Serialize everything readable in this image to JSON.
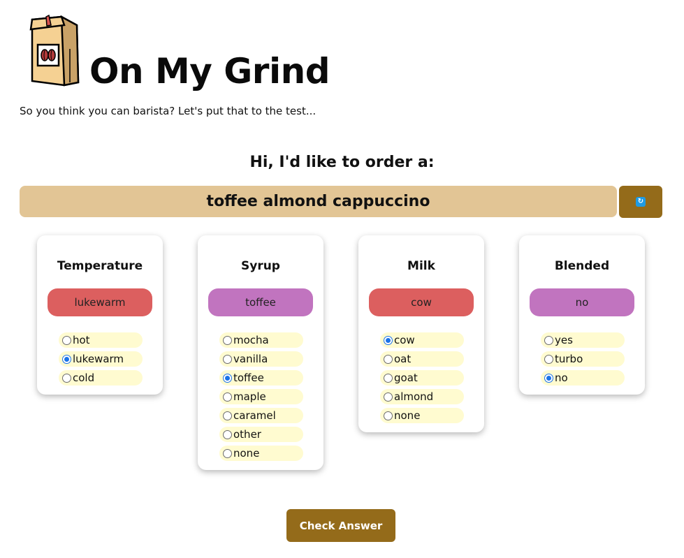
{
  "header": {
    "logo_icon": "coffee-bag-icon",
    "title": "On My Grind",
    "tagline": "So you think you can barista? Let's put that to the test..."
  },
  "order": {
    "prompt": "Hi, I'd like to order a:",
    "drink": "toffee almond cappuccino",
    "refresh_icon": "refresh-icon"
  },
  "colors": {
    "wrong": "#dc5f5f",
    "correct": "#c174bf",
    "order_bar": "#e2c595",
    "brand": "#946b1a",
    "option_bg": "#fffbd0"
  },
  "cards": [
    {
      "title": "Temperature",
      "selected": "lukewarm",
      "status": "wrong",
      "options": [
        {
          "label": "hot",
          "checked": false
        },
        {
          "label": "lukewarm",
          "checked": true
        },
        {
          "label": "cold",
          "checked": false
        }
      ]
    },
    {
      "title": "Syrup",
      "selected": "toffee",
      "status": "correct",
      "options": [
        {
          "label": "mocha",
          "checked": false
        },
        {
          "label": "vanilla",
          "checked": false
        },
        {
          "label": "toffee",
          "checked": true
        },
        {
          "label": "maple",
          "checked": false
        },
        {
          "label": "caramel",
          "checked": false
        },
        {
          "label": "other",
          "checked": false
        },
        {
          "label": "none",
          "checked": false
        }
      ]
    },
    {
      "title": "Milk",
      "selected": "cow",
      "status": "wrong",
      "options": [
        {
          "label": "cow",
          "checked": true
        },
        {
          "label": "oat",
          "checked": false
        },
        {
          "label": "goat",
          "checked": false
        },
        {
          "label": "almond",
          "checked": false
        },
        {
          "label": "none",
          "checked": false
        }
      ]
    },
    {
      "title": "Blended",
      "selected": "no",
      "status": "correct",
      "options": [
        {
          "label": "yes",
          "checked": false
        },
        {
          "label": "turbo",
          "checked": false
        },
        {
          "label": "no",
          "checked": true
        }
      ]
    }
  ],
  "check_button": {
    "label": "Check Answer"
  }
}
